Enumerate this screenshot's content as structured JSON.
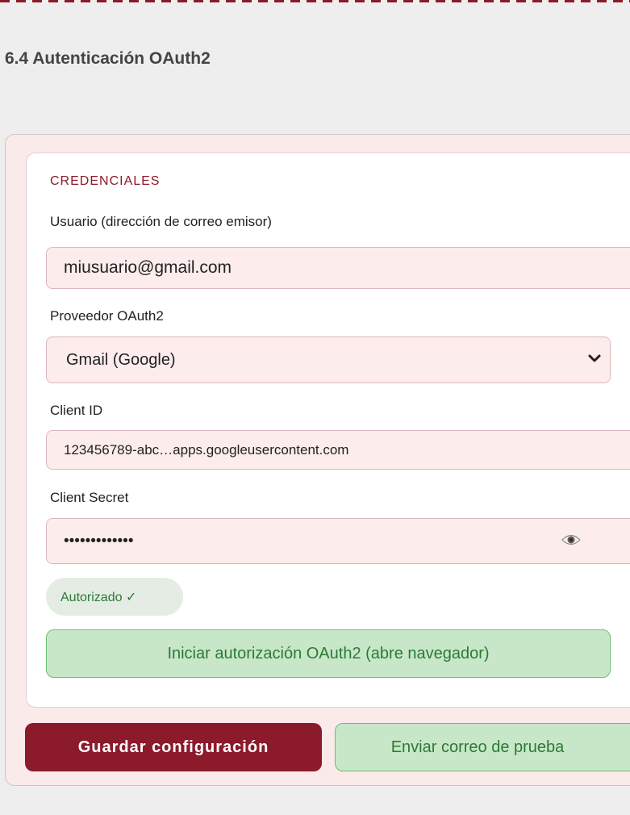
{
  "section": {
    "title": "6.4 Autenticación OAuth2"
  },
  "credentials": {
    "legend": "CREDENCIALES",
    "user_label": "Usuario (dirección de correo emisor)",
    "user_value": "miusuario@gmail.com",
    "provider_label": "Proveedor OAuth2",
    "provider_value": "Gmail (Google)",
    "client_id_label": "Client ID",
    "client_id_value": "123456789-abc…apps.googleusercontent.com",
    "client_secret_label": "Client Secret",
    "client_secret_value": "•••••••••••••",
    "status_badge": "Autorizado ✓",
    "authorize_button": "Iniciar autorización OAuth2 (abre navegador)"
  },
  "actions": {
    "save_button": "Guardar configuración",
    "test_button": "Enviar correo de prueba"
  },
  "icons": {
    "provider_dropdown": "chevron-down-icon",
    "show_secret": "eye-icon"
  },
  "colors": {
    "accent": "#8b1a2b",
    "success": "#2c7a35",
    "success_bg": "#c8e7c9"
  }
}
